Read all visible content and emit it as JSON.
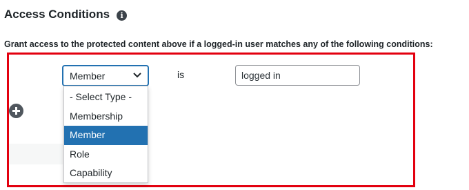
{
  "section": {
    "title": "Access Conditions",
    "info_icon": "info-icon",
    "description": "Grant access to the protected content above if a logged-in user matches any of the following conditions:"
  },
  "condition": {
    "type_value": "Member",
    "operator": "is",
    "value": "logged in"
  },
  "dropdown": {
    "options": [
      "- Select Type -",
      "Membership",
      "Member",
      "Role",
      "Capability"
    ],
    "selected": "Member"
  },
  "add_icon": "plus-circle-icon",
  "colors": {
    "highlight": "#e3000f",
    "accent": "#2271b1"
  }
}
